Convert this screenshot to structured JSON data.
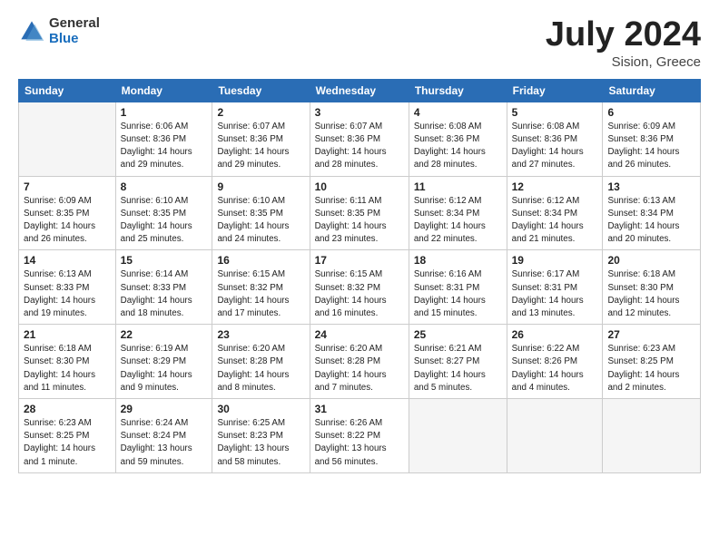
{
  "header": {
    "logo": {
      "general": "General",
      "blue": "Blue"
    },
    "title": "July 2024",
    "location": "Sision, Greece"
  },
  "weekdays": [
    "Sunday",
    "Monday",
    "Tuesday",
    "Wednesday",
    "Thursday",
    "Friday",
    "Saturday"
  ],
  "weeks": [
    [
      {
        "day": "",
        "info": ""
      },
      {
        "day": "1",
        "info": "Sunrise: 6:06 AM\nSunset: 8:36 PM\nDaylight: 14 hours\nand 29 minutes."
      },
      {
        "day": "2",
        "info": "Sunrise: 6:07 AM\nSunset: 8:36 PM\nDaylight: 14 hours\nand 29 minutes."
      },
      {
        "day": "3",
        "info": "Sunrise: 6:07 AM\nSunset: 8:36 PM\nDaylight: 14 hours\nand 28 minutes."
      },
      {
        "day": "4",
        "info": "Sunrise: 6:08 AM\nSunset: 8:36 PM\nDaylight: 14 hours\nand 28 minutes."
      },
      {
        "day": "5",
        "info": "Sunrise: 6:08 AM\nSunset: 8:36 PM\nDaylight: 14 hours\nand 27 minutes."
      },
      {
        "day": "6",
        "info": "Sunrise: 6:09 AM\nSunset: 8:36 PM\nDaylight: 14 hours\nand 26 minutes."
      }
    ],
    [
      {
        "day": "7",
        "info": "Sunrise: 6:09 AM\nSunset: 8:35 PM\nDaylight: 14 hours\nand 26 minutes."
      },
      {
        "day": "8",
        "info": "Sunrise: 6:10 AM\nSunset: 8:35 PM\nDaylight: 14 hours\nand 25 minutes."
      },
      {
        "day": "9",
        "info": "Sunrise: 6:10 AM\nSunset: 8:35 PM\nDaylight: 14 hours\nand 24 minutes."
      },
      {
        "day": "10",
        "info": "Sunrise: 6:11 AM\nSunset: 8:35 PM\nDaylight: 14 hours\nand 23 minutes."
      },
      {
        "day": "11",
        "info": "Sunrise: 6:12 AM\nSunset: 8:34 PM\nDaylight: 14 hours\nand 22 minutes."
      },
      {
        "day": "12",
        "info": "Sunrise: 6:12 AM\nSunset: 8:34 PM\nDaylight: 14 hours\nand 21 minutes."
      },
      {
        "day": "13",
        "info": "Sunrise: 6:13 AM\nSunset: 8:34 PM\nDaylight: 14 hours\nand 20 minutes."
      }
    ],
    [
      {
        "day": "14",
        "info": "Sunrise: 6:13 AM\nSunset: 8:33 PM\nDaylight: 14 hours\nand 19 minutes."
      },
      {
        "day": "15",
        "info": "Sunrise: 6:14 AM\nSunset: 8:33 PM\nDaylight: 14 hours\nand 18 minutes."
      },
      {
        "day": "16",
        "info": "Sunrise: 6:15 AM\nSunset: 8:32 PM\nDaylight: 14 hours\nand 17 minutes."
      },
      {
        "day": "17",
        "info": "Sunrise: 6:15 AM\nSunset: 8:32 PM\nDaylight: 14 hours\nand 16 minutes."
      },
      {
        "day": "18",
        "info": "Sunrise: 6:16 AM\nSunset: 8:31 PM\nDaylight: 14 hours\nand 15 minutes."
      },
      {
        "day": "19",
        "info": "Sunrise: 6:17 AM\nSunset: 8:31 PM\nDaylight: 14 hours\nand 13 minutes."
      },
      {
        "day": "20",
        "info": "Sunrise: 6:18 AM\nSunset: 8:30 PM\nDaylight: 14 hours\nand 12 minutes."
      }
    ],
    [
      {
        "day": "21",
        "info": "Sunrise: 6:18 AM\nSunset: 8:30 PM\nDaylight: 14 hours\nand 11 minutes."
      },
      {
        "day": "22",
        "info": "Sunrise: 6:19 AM\nSunset: 8:29 PM\nDaylight: 14 hours\nand 9 minutes."
      },
      {
        "day": "23",
        "info": "Sunrise: 6:20 AM\nSunset: 8:28 PM\nDaylight: 14 hours\nand 8 minutes."
      },
      {
        "day": "24",
        "info": "Sunrise: 6:20 AM\nSunset: 8:28 PM\nDaylight: 14 hours\nand 7 minutes."
      },
      {
        "day": "25",
        "info": "Sunrise: 6:21 AM\nSunset: 8:27 PM\nDaylight: 14 hours\nand 5 minutes."
      },
      {
        "day": "26",
        "info": "Sunrise: 6:22 AM\nSunset: 8:26 PM\nDaylight: 14 hours\nand 4 minutes."
      },
      {
        "day": "27",
        "info": "Sunrise: 6:23 AM\nSunset: 8:25 PM\nDaylight: 14 hours\nand 2 minutes."
      }
    ],
    [
      {
        "day": "28",
        "info": "Sunrise: 6:23 AM\nSunset: 8:25 PM\nDaylight: 14 hours\nand 1 minute."
      },
      {
        "day": "29",
        "info": "Sunrise: 6:24 AM\nSunset: 8:24 PM\nDaylight: 13 hours\nand 59 minutes."
      },
      {
        "day": "30",
        "info": "Sunrise: 6:25 AM\nSunset: 8:23 PM\nDaylight: 13 hours\nand 58 minutes."
      },
      {
        "day": "31",
        "info": "Sunrise: 6:26 AM\nSunset: 8:22 PM\nDaylight: 13 hours\nand 56 minutes."
      },
      {
        "day": "",
        "info": ""
      },
      {
        "day": "",
        "info": ""
      },
      {
        "day": "",
        "info": ""
      }
    ]
  ]
}
